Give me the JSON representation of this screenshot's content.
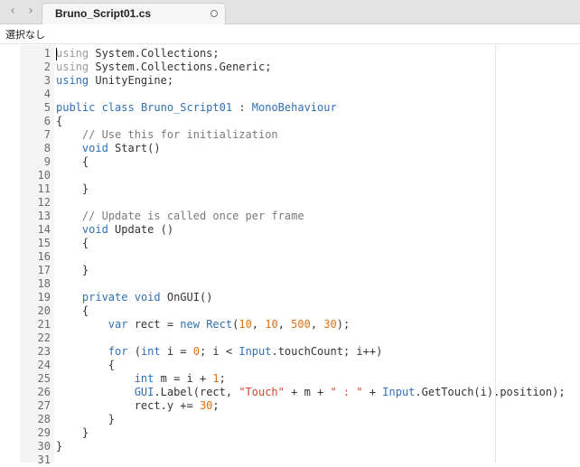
{
  "window": {
    "tab_title": "Bruno_Script01.cs",
    "selection_status": "選択なし",
    "back_glyph": "‹",
    "forward_glyph": "›"
  },
  "colors": {
    "keyword": "#2f6fb5",
    "comment": "#7a7a7a",
    "number": "#e0700f",
    "string": "#d1442a"
  },
  "code_lines": [
    {
      "num": "1",
      "tokens": [
        {
          "t": "using",
          "c": "us"
        },
        {
          "t": " System.Collections;"
        }
      ]
    },
    {
      "num": "2",
      "tokens": [
        {
          "t": "using",
          "c": "us"
        },
        {
          "t": " System.Collections.Generic;"
        }
      ]
    },
    {
      "num": "3",
      "tokens": [
        {
          "t": "using",
          "c": "kw"
        },
        {
          "t": " UnityEngine;"
        }
      ]
    },
    {
      "num": "4",
      "tokens": []
    },
    {
      "num": "5",
      "tokens": [
        {
          "t": "public class",
          "c": "kw"
        },
        {
          "t": " "
        },
        {
          "t": "Bruno_Script01",
          "c": "ty"
        },
        {
          "t": " : "
        },
        {
          "t": "MonoBehaviour",
          "c": "ty"
        }
      ]
    },
    {
      "num": "6",
      "tokens": [
        {
          "t": "{"
        }
      ]
    },
    {
      "num": "7",
      "tokens": [
        {
          "t": "    "
        },
        {
          "t": "// Use this for initialization",
          "c": "cm"
        }
      ]
    },
    {
      "num": "8",
      "tokens": [
        {
          "t": "    "
        },
        {
          "t": "void",
          "c": "kw"
        },
        {
          "t": " Start()"
        }
      ]
    },
    {
      "num": "9",
      "tokens": [
        {
          "t": "    {"
        }
      ]
    },
    {
      "num": "10",
      "tokens": []
    },
    {
      "num": "11",
      "tokens": [
        {
          "t": "    }"
        }
      ]
    },
    {
      "num": "12",
      "tokens": []
    },
    {
      "num": "13",
      "tokens": [
        {
          "t": "    "
        },
        {
          "t": "// Update is called once per frame",
          "c": "cm"
        }
      ]
    },
    {
      "num": "14",
      "tokens": [
        {
          "t": "    "
        },
        {
          "t": "void",
          "c": "kw"
        },
        {
          "t": " Update ()"
        }
      ]
    },
    {
      "num": "15",
      "tokens": [
        {
          "t": "    {"
        }
      ]
    },
    {
      "num": "16",
      "tokens": []
    },
    {
      "num": "17",
      "tokens": [
        {
          "t": "    }"
        }
      ]
    },
    {
      "num": "18",
      "tokens": []
    },
    {
      "num": "19",
      "tokens": [
        {
          "t": "    "
        },
        {
          "t": "private",
          "c": "kw"
        },
        {
          "t": " "
        },
        {
          "t": "void",
          "c": "kw"
        },
        {
          "t": " OnGUI()"
        }
      ]
    },
    {
      "num": "20",
      "tokens": [
        {
          "t": "    {"
        }
      ]
    },
    {
      "num": "21",
      "tokens": [
        {
          "t": "        "
        },
        {
          "t": "var",
          "c": "kw"
        },
        {
          "t": " rect = "
        },
        {
          "t": "new",
          "c": "kw"
        },
        {
          "t": " "
        },
        {
          "t": "Rect",
          "c": "ty"
        },
        {
          "t": "("
        },
        {
          "t": "10",
          "c": "nu"
        },
        {
          "t": ", "
        },
        {
          "t": "10",
          "c": "nu"
        },
        {
          "t": ", "
        },
        {
          "t": "500",
          "c": "nu"
        },
        {
          "t": ", "
        },
        {
          "t": "30",
          "c": "nu"
        },
        {
          "t": ");"
        }
      ]
    },
    {
      "num": "22",
      "tokens": []
    },
    {
      "num": "23",
      "tokens": [
        {
          "t": "        "
        },
        {
          "t": "for",
          "c": "kw"
        },
        {
          "t": " ("
        },
        {
          "t": "int",
          "c": "kw"
        },
        {
          "t": " i = "
        },
        {
          "t": "0",
          "c": "nu"
        },
        {
          "t": "; i < "
        },
        {
          "t": "Input",
          "c": "ty"
        },
        {
          "t": ".touchCount; i++)"
        }
      ]
    },
    {
      "num": "24",
      "tokens": [
        {
          "t": "        {"
        }
      ]
    },
    {
      "num": "25",
      "tokens": [
        {
          "t": "            "
        },
        {
          "t": "int",
          "c": "kw"
        },
        {
          "t": " m = i + "
        },
        {
          "t": "1",
          "c": "nu"
        },
        {
          "t": ";"
        }
      ]
    },
    {
      "num": "26",
      "tokens": [
        {
          "t": "            "
        },
        {
          "t": "GUI",
          "c": "ty"
        },
        {
          "t": ".Label(rect, "
        },
        {
          "t": "\"Touch\"",
          "c": "st"
        },
        {
          "t": " + m + "
        },
        {
          "t": "\" : \"",
          "c": "st"
        },
        {
          "t": " + "
        },
        {
          "t": "Input",
          "c": "ty"
        },
        {
          "t": ".GetTouch(i).position);"
        }
      ]
    },
    {
      "num": "27",
      "tokens": [
        {
          "t": "            rect.y += "
        },
        {
          "t": "30",
          "c": "nu"
        },
        {
          "t": ";"
        }
      ]
    },
    {
      "num": "28",
      "tokens": [
        {
          "t": "        }"
        }
      ]
    },
    {
      "num": "29",
      "tokens": [
        {
          "t": "    }"
        }
      ]
    },
    {
      "num": "30",
      "tokens": [
        {
          "t": "}"
        }
      ]
    },
    {
      "num": "31",
      "tokens": []
    }
  ]
}
